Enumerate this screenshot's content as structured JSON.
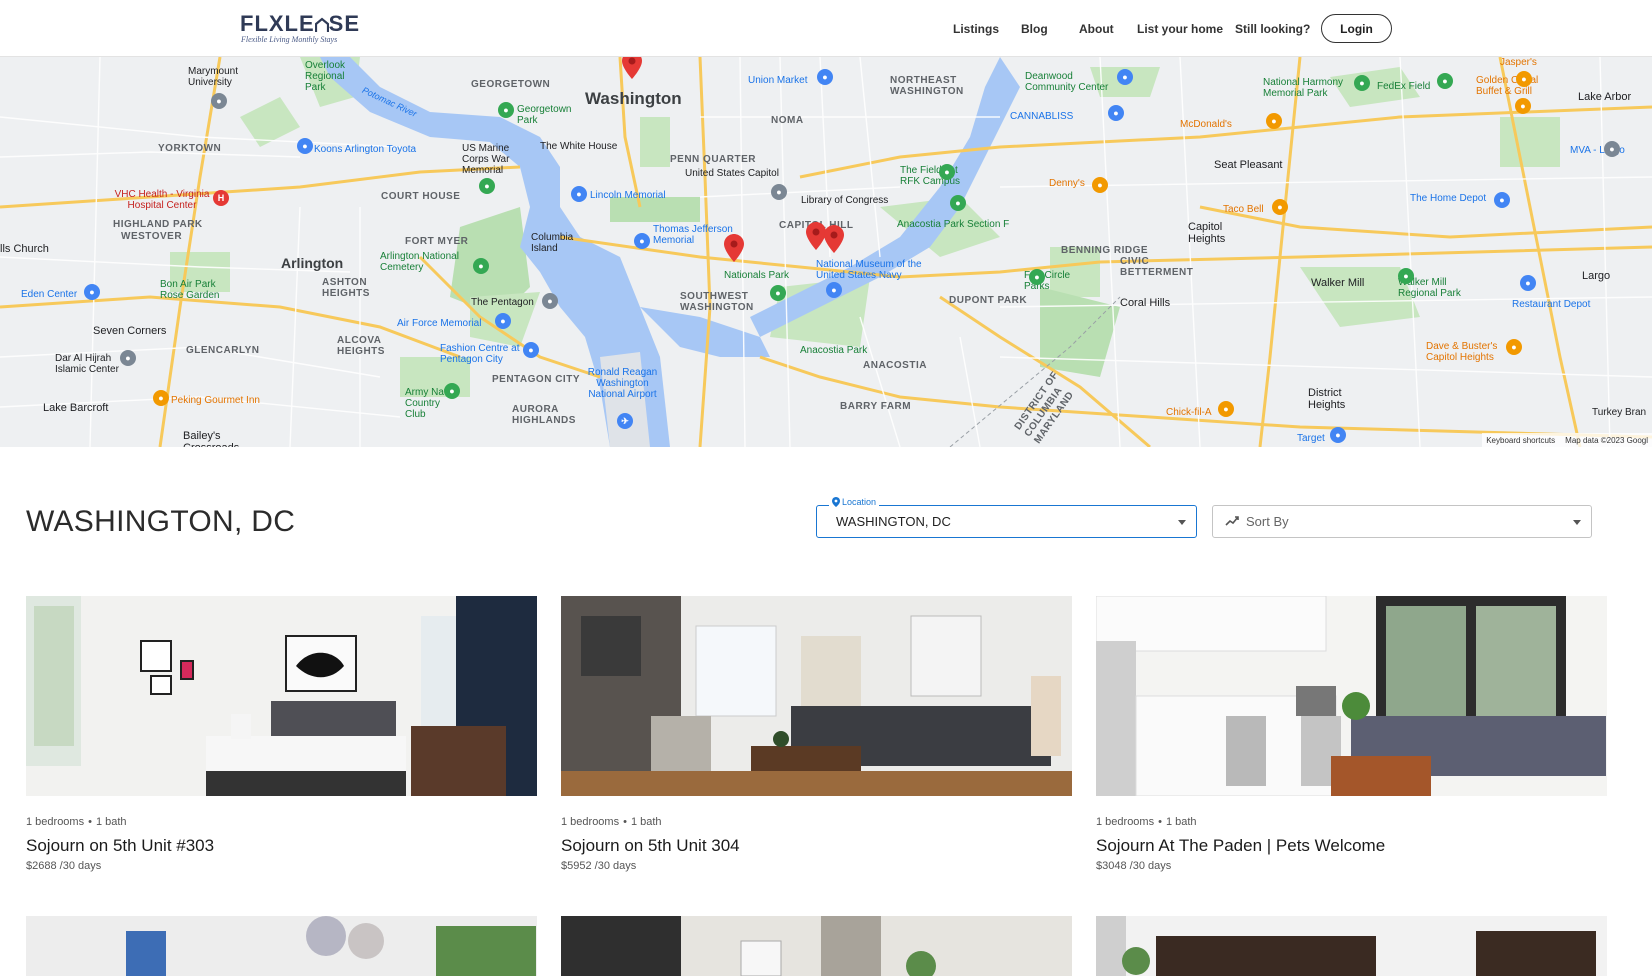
{
  "header": {
    "logo_main": "FLXLE",
    "logo_main_2": "SE",
    "logo_tagline": "Flexible Living Monthly Stays",
    "nav": [
      "Listings",
      "Blog",
      "About",
      "List your home",
      "Still looking?"
    ],
    "login_label": "Login"
  },
  "map": {
    "labels": {
      "washington": "Washington",
      "arlington": "Arlington",
      "georgetown": "GEORGETOWN",
      "yorktown": "YORKTOWN",
      "court_house": "COURT HOUSE",
      "highland_park": "HIGHLAND PARK",
      "westover": "WESTOVER",
      "fort_myer": "FORT MYER",
      "ashton_heights": "ASHTON HEIGHTS",
      "glencarlyn": "GLENCARLYN",
      "alcova_heights": "ALCOVA HEIGHTS",
      "pentagon_city": "PENTAGON CITY",
      "aurora_highlands": "AURORA HIGHLANDS",
      "noma": "NOMA",
      "penn_quarter": "PENN QUARTER",
      "capitol_hill": "CAPITOL HILL",
      "southwest_washington": "SOUTHWEST WASHINGTON",
      "northeast_washington": "NORTHEAST WASHINGTON",
      "benning_ridge": "BENNING RIDGE",
      "civic_betterment": "CIVIC BETTERMENT",
      "dupont_park": "DUPONT PARK",
      "anacostia": "ANACOSTIA",
      "barry_farm": "BARRY FARM",
      "seat_pleasant": "Seat Pleasant",
      "capitol_heights": "Capitol Heights",
      "walker_mill": "Walker Mill",
      "coral_hills": "Coral Hills",
      "district_heights": "District Heights",
      "largo": "Largo",
      "lake_arbor": "Lake Arbor",
      "seven_corners": "Seven Corners",
      "lake_barcroft": "Lake Barcroft",
      "baileys": "Bailey's Crossroads",
      "falls_church": "lls Church",
      "marymount": "Marymount University",
      "overlook": "Overlook Regional Park",
      "georgetown_park": "Georgetown Park",
      "white_house": "The White House",
      "us_marine": "US Marine Corps War Memorial",
      "lincoln": "Lincoln Memorial",
      "columbia_island": "Columbia Island",
      "thomas_jefferson": "Thomas Jefferson Memorial",
      "arlington_cemetery": "Arlington National Cemetery",
      "pentagon": "The Pentagon",
      "air_force": "Air Force Memorial",
      "fashion_centre": "Fashion Centre at Pentagon City",
      "army_navy": "Army Navy Country Club",
      "reagan": "Ronald Reagan Washington National Airport",
      "nationals_park": "Nationals Park",
      "navy_museum": "National Museum of the United States Navy",
      "union_market": "Union Market",
      "capitol": "United States Capitol",
      "library": "Library of Congress",
      "rfk": "The Fields at RFK Campus",
      "anacostia_f": "Anacostia Park Section F",
      "anacostia_park": "Anacostia Park",
      "fort_circle": "Fort Circle Parks",
      "deanwood": "Deanwood Community Center",
      "cannabliss": "CANNABLISS",
      "national_harmony": "National Harmony Memorial Park",
      "fedex": "FedEx Field",
      "jaspers": "Jasper's",
      "golden_corral": "Golden Corral Buffet & Grill",
      "mcdonalds": "McDonald's",
      "dennys": "Denny's",
      "taco_bell": "Taco Bell",
      "home_depot": "The Home Depot",
      "walker_mill_park": "Walker Mill Regional Park",
      "restaurant_depot": "Restaurant Depot",
      "dave_busters": "Dave & Buster's Capitol Heights",
      "chick_fil_a": "Chick-fil-A",
      "target": "Target",
      "mva": "MVA - Largo",
      "turkey_branch": "Turkey Bran",
      "koons": "Koons Arlington Toyota",
      "vhc": "VHC Health - Virginia Hospital Center",
      "eden_center": "Eden Center",
      "bon_air": "Bon Air Park Rose Garden",
      "dar_al_hijrah": "Dar Al Hijrah Islamic Center",
      "peking": "Peking Gourmet Inn",
      "dc_md": "DISTRICT OF COLUMBIA MARYLAND",
      "potomac": "Potomac River"
    },
    "footer_shortcuts": "Keyboard shortcuts",
    "footer_data": "Map data ©2023 Googl"
  },
  "page": {
    "title": "WASHINGTON, DC"
  },
  "filters": {
    "location_label": "Location",
    "location_value": "WASHINGTON, DC",
    "sort_label": "Sort By"
  },
  "listings": [
    {
      "beds": "1 bedrooms",
      "baths": "1 bath",
      "title": "Sojourn on 5th Unit #303",
      "price": "$2688 /30 days"
    },
    {
      "beds": "1 bedrooms",
      "baths": "1 bath",
      "title": "Sojourn on 5th Unit 304",
      "price": "$5952 /30 days"
    },
    {
      "beds": "1 bedrooms",
      "baths": "1 bath",
      "title": "Sojourn At The Paden | Pets Welcome",
      "price": "$3048 /30 days"
    }
  ],
  "colors": {
    "pin": "#e53935",
    "water": "#a7c7f5",
    "park": "#b7e0b0",
    "accent": "#1976d2"
  }
}
